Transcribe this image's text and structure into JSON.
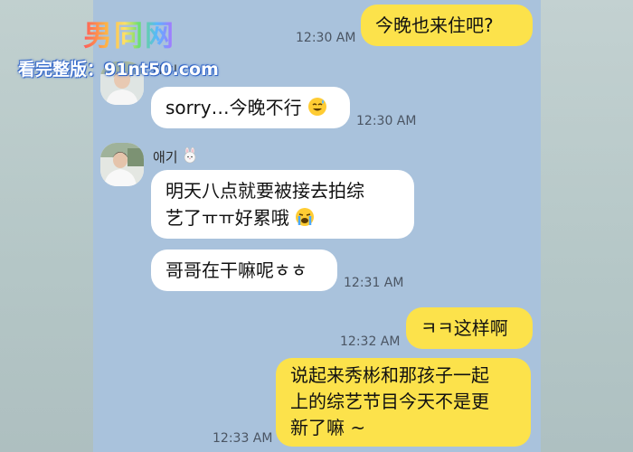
{
  "watermark": {
    "logo_text": "男同网",
    "url_text": "看完整版：91nt50.com"
  },
  "contact": {
    "name": "애기",
    "name_icon": "rabbit-face-icon"
  },
  "messages": [
    {
      "from": "me",
      "text": "今晚也来住吧?",
      "time": "12:30 AM"
    },
    {
      "from": "them",
      "text": "sorry…今晚不行",
      "emoji": "sweat-smile-icon",
      "time": "12:30 AM"
    },
    {
      "from": "them",
      "line1": "明天八点就要被接去拍综",
      "line2": "艺了ㅠㅠ好累哦",
      "emoji": "crying-face-icon"
    },
    {
      "from": "them",
      "text": "哥哥在干嘛呢ㅎㅎ",
      "time": "12:31 AM"
    },
    {
      "from": "me",
      "text": "ㅋㅋ这样啊",
      "time": "12:32 AM"
    },
    {
      "from": "me",
      "line1": "说起来秀彬和那孩子一起",
      "line2": "上的综艺节目今天不是更",
      "line3": "新了嘛 ~",
      "time": "12:33 AM"
    }
  ],
  "colors": {
    "chat_background": "#a9c2dc",
    "my_bubble": "#fce24b",
    "their_bubble": "#ffffff"
  }
}
